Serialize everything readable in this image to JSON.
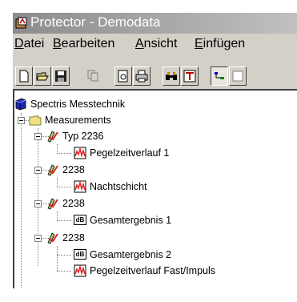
{
  "window": {
    "title": "Protector - Demodata"
  },
  "menu": [
    {
      "accel": "D",
      "rest": "atei"
    },
    {
      "accel": "B",
      "rest": "earbeiten"
    },
    {
      "accel": "A",
      "rest": "nsicht"
    },
    {
      "accel": "E",
      "rest": "infügen"
    }
  ],
  "toolbar": {
    "buttons": [
      "new-icon",
      "open-icon",
      "save-icon",
      "copy-icon",
      "print-preview-icon",
      "print-icon",
      "binoculars-icon",
      "filter-icon",
      "tree-view-icon",
      "list-view-icon"
    ]
  },
  "tree": {
    "root": "Spectris Messtechnik",
    "folder": "Measurements",
    "items": [
      "Typ 2236",
      "Pegelzeitverlauf 1",
      "2238",
      "Nachtschicht",
      "2238",
      "Gesamtergebnis 1",
      "2238",
      "Gesamtergebnis 2",
      "Pegelzeitverlauf Fast/Impuls"
    ],
    "db_badge": "dB"
  }
}
